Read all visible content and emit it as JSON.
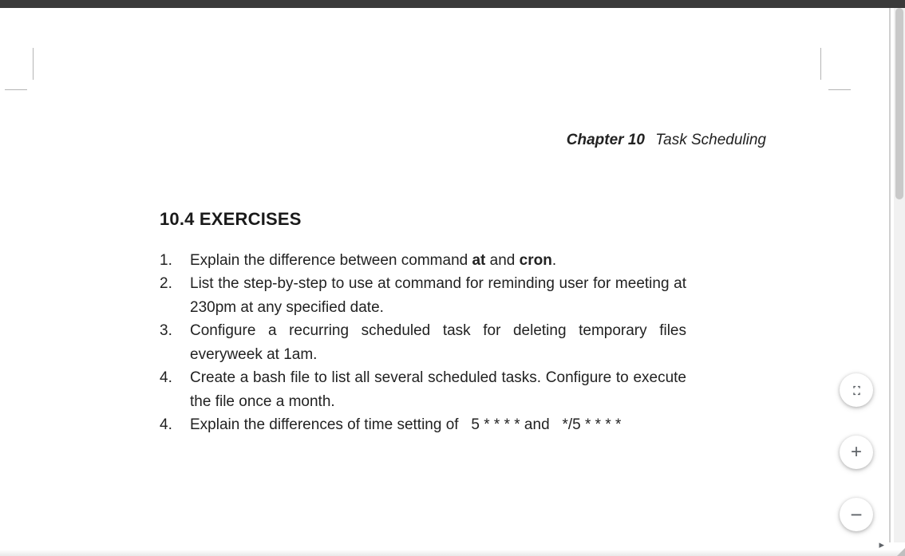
{
  "chapter": {
    "label": "Chapter 10",
    "title": "Task Scheduling"
  },
  "section": {
    "heading": "10.4 EXERCISES"
  },
  "exercises": [
    {
      "n": "1.",
      "html": "Explain the difference between command <b>at</b> and <b>cron</b>."
    },
    {
      "n": "2.",
      "html": "List the step-by-step to use at command for reminding user for meeting at 230pm at any specified date."
    },
    {
      "n": "3.",
      "html": "Configure a recurring scheduled task for deleting temporary files everyweek at 1am."
    },
    {
      "n": "4.",
      "html": "Create a bash file to list all several scheduled tasks. Configure to execute the file once a month."
    },
    {
      "n": "4.",
      "html": "Explain the differences of time setting of &nbsp; 5 * * * * and &nbsp; */5 * * * *"
    }
  ],
  "controls": {
    "fit": "Fit to page",
    "zoom_in": "+",
    "zoom_out": "−"
  }
}
